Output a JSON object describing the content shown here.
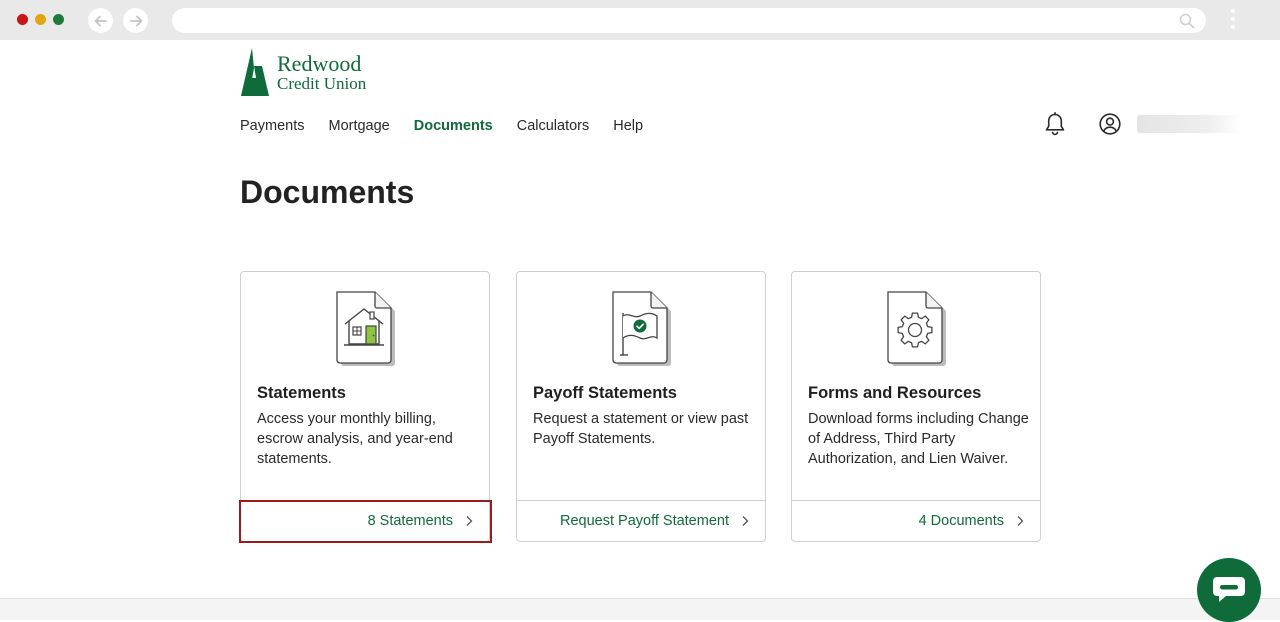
{
  "brand": {
    "name_line1": "Redwood",
    "name_line2": "Credit Union",
    "color": "#0f6b3a"
  },
  "nav": {
    "items": [
      {
        "label": "Payments",
        "active": false
      },
      {
        "label": "Mortgage",
        "active": false
      },
      {
        "label": "Documents",
        "active": true
      },
      {
        "label": "Calculators",
        "active": false
      },
      {
        "label": "Help",
        "active": false
      }
    ]
  },
  "header_icons": {
    "notifications": "bell-icon",
    "account": "user-circle-icon"
  },
  "page": {
    "title": "Documents"
  },
  "cards": [
    {
      "icon": "house-document-icon",
      "title": "Statements",
      "description": "Access your monthly billing, escrow analysis, and year-end statements.",
      "link": "8 Statements",
      "highlighted": true
    },
    {
      "icon": "flag-check-document-icon",
      "title": "Payoff Statements",
      "description": "Request a statement or view past Payoff Statements.",
      "link": "Request Payoff Statement",
      "highlighted": false
    },
    {
      "icon": "gear-document-icon",
      "title": "Forms and Resources",
      "description": "Download forms including Change of Address, Third Party Authorization, and Lien Waiver.",
      "link": "4 Documents",
      "highlighted": false
    }
  ],
  "colors": {
    "accent": "#0f6b3a",
    "highlight_border": "#9b1c1c",
    "house_door": "#8cc63f"
  },
  "chat_widget": {
    "icon": "chat-bubble-icon"
  }
}
